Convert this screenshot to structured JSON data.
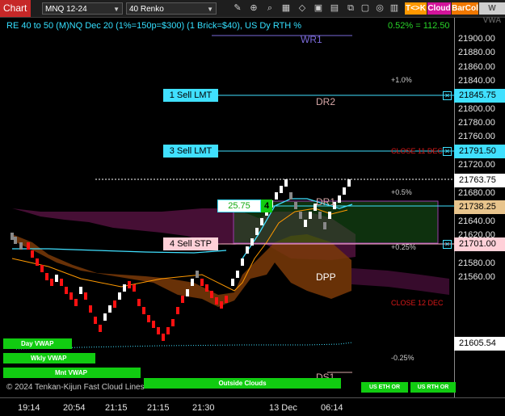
{
  "toolbar": {
    "chart_tab": "Chart",
    "instrument": "MNQ 12-24",
    "bar_type": "40 Renko",
    "tc_pill": "T<>K",
    "cloud_pill": "Cloud",
    "barcol_pill": "BarCol",
    "vw_pill": "W VWA"
  },
  "header": {
    "title": "RE 40 to 50 (M)NQ Dec 20 (1%=150p=$300) (1 Brick=$40), US Dy RTH %",
    "pct_change": "0.52% = 112.50"
  },
  "levels": {
    "wr1": "WR1",
    "dr2": "DR2",
    "dr1": "DR1",
    "dpp": "DPP",
    "ds1": "DS1",
    "plus1": "+1.0%",
    "plus05": "+0.5%",
    "plus025": "+0.25%",
    "minus025": "-0.25%",
    "close11": "CLOSE 11 DEC",
    "close12": "CLOSE 12 DEC"
  },
  "orders": {
    "sell_lmt_1": "1 Sell LMT",
    "sell_lmt_3": "3 Sell LMT",
    "sell_stp_4": "4 Sell STP"
  },
  "position": {
    "pnl": "25.75",
    "qty": "4"
  },
  "price_boxes": {
    "p21845": "21845.75",
    "p21791": "21791.50",
    "p21763": "21763.75",
    "p21738": "21738.25",
    "p21701": "21701.00",
    "p21605": "21605.54"
  },
  "price_ticks": [
    "21900.00",
    "21880.00",
    "21860.00",
    "21840.00",
    "21820.00",
    "21800.00",
    "21780.00",
    "21760.00",
    "21740.00",
    "21720.00",
    "21700.00",
    "21680.00",
    "21660.00",
    "21640.00",
    "21620.00",
    "21600.00",
    "21580.00",
    "21560.00"
  ],
  "time_labels": [
    "19:14",
    "20:54",
    "21:15",
    "21:15",
    "21:30",
    "13 Dec",
    "06:14"
  ],
  "status_bars": {
    "day_vwap": "Day VWAP",
    "wkly_vwap": "Wkly VWAP",
    "mnt_vwap": "Mnt VWAP",
    "outside_clouds": "Outside Clouds",
    "us_eth": "US ETH OR",
    "us_rth": "US RTH OR",
    "watermark": "© 2024 Tenkan-Kijun Fast Cloud Lines"
  },
  "colors": {
    "bull": "#ffffff",
    "bear": "#ff1111",
    "order_line": "#40e0ff",
    "accent": "#11cc11"
  }
}
